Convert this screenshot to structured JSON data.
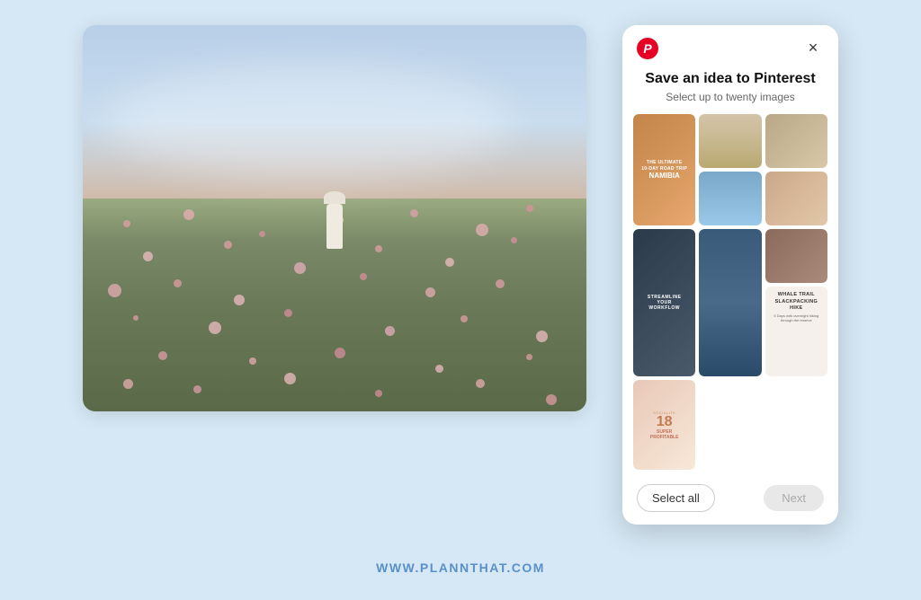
{
  "page": {
    "background_color": "#d6e8f5",
    "website_url": "WWW.PLANNTHAT.COM"
  },
  "dialog": {
    "title": "Save an idea to Pinterest",
    "subtitle": "Select up to twenty images",
    "pinterest_icon": "P",
    "close_icon": "×",
    "select_all_label": "Select all",
    "next_label": "Next",
    "images": [
      {
        "id": "namibia",
        "type": "namibia",
        "label": "The Ultimate 10-Day Road Trip NAMIBIA",
        "span": "tall"
      },
      {
        "id": "desert-tree",
        "type": "desert_tree",
        "label": "Desert with lone tree"
      },
      {
        "id": "rocks",
        "type": "rocks",
        "label": "Rock formations"
      },
      {
        "id": "blue-sky",
        "type": "blue_sky",
        "label": "Blue sky landscape"
      },
      {
        "id": "adobe",
        "type": "adobe",
        "label": "Adobe building"
      },
      {
        "id": "dark-person",
        "type": "dark_person",
        "label": "Streamline your Workflow",
        "span": "tall"
      },
      {
        "id": "waterfall",
        "type": "waterfall",
        "label": "Waterfall scene",
        "span": "tall"
      },
      {
        "id": "canyon",
        "type": "canyon",
        "label": "Canyon landscape"
      },
      {
        "id": "whale-trail",
        "type": "whale_trail",
        "label": "Whale Trail Slackpacking Hike"
      },
      {
        "id": "super-profitable",
        "type": "super_profitable",
        "label": "18 Super Profitable"
      }
    ]
  }
}
